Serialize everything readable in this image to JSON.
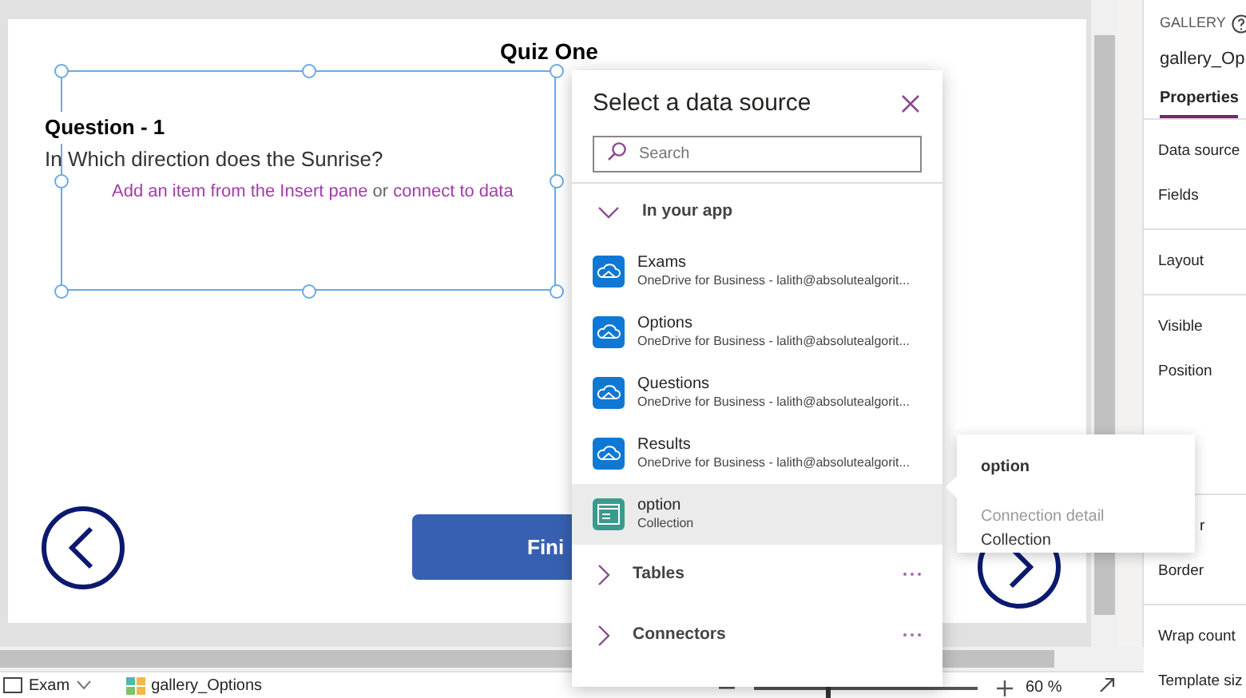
{
  "canvas": {
    "title": "Quiz One",
    "question_label": "Question - 1",
    "question_text": "In Which direction does the Sunrise?",
    "gallery_hint": [
      {
        "text": "Add an item from the Insert pane",
        "kind": "link"
      },
      {
        "text": "or",
        "kind": "plain"
      },
      {
        "text": "connect to data",
        "kind": "link"
      }
    ],
    "finish_button": "Fini"
  },
  "data_source_panel": {
    "title": "Select a data source",
    "search": {
      "placeholder": "Search"
    },
    "sections": [
      {
        "label": "In your app",
        "expanded": true,
        "items": [
          {
            "name": "Exams",
            "detail": "OneDrive for Business - lalith@absolutealgorit...",
            "kind": "onedrive",
            "selected": false
          },
          {
            "name": "Options",
            "detail": "OneDrive for Business - lalith@absolutealgorit...",
            "kind": "onedrive",
            "selected": false
          },
          {
            "name": "Questions",
            "detail": "OneDrive for Business - lalith@absolutealgorit...",
            "kind": "onedrive",
            "selected": false
          },
          {
            "name": "Results",
            "detail": "OneDrive for Business - lalith@absolutealgorit...",
            "kind": "onedrive",
            "selected": false
          },
          {
            "name": "option",
            "detail": "Collection",
            "kind": "collection",
            "selected": true
          }
        ]
      },
      {
        "label": "Tables",
        "expanded": false
      },
      {
        "label": "Connectors",
        "expanded": false
      }
    ]
  },
  "tooltip": {
    "title": "option",
    "label": "Connection detail",
    "value": "Collection"
  },
  "properties_pane": {
    "type_label": "GALLERY",
    "control_name": "gallery_Op",
    "tabs": [
      {
        "label": "Properties",
        "selected": true
      }
    ],
    "groups": [
      [
        {
          "label": "Data source"
        },
        {
          "label": "Fields"
        }
      ],
      [
        {
          "label": "Layout"
        }
      ],
      [
        {
          "label": "Visible"
        },
        {
          "label": "Position"
        }
      ],
      [
        {
          "label": "r",
          "kind": "covered"
        },
        {
          "label": "Border"
        }
      ],
      [
        {
          "label": "Wrap count"
        },
        {
          "label": "Template siz"
        }
      ]
    ]
  },
  "status_bar": {
    "screen": "Exam",
    "control": "gallery_Options",
    "zoom": {
      "level": 0.32,
      "reading": "60 %"
    }
  }
}
